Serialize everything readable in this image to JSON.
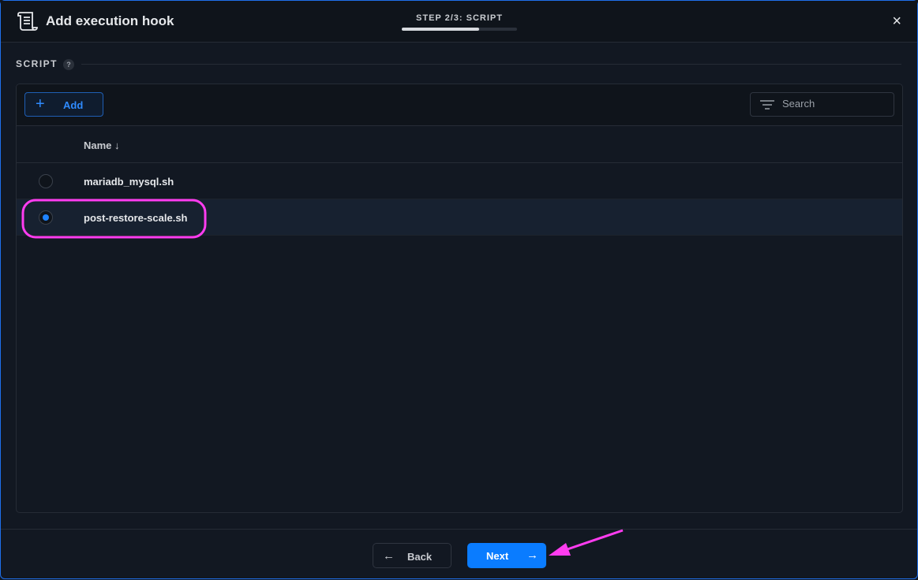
{
  "header": {
    "title": "Add execution hook",
    "step_label": "STEP 2/3: SCRIPT",
    "progress": 0.67,
    "close_icon": "×"
  },
  "section": {
    "title": "SCRIPT",
    "help": "?"
  },
  "toolbar": {
    "add_label": "Add",
    "add_icon": "+",
    "search_placeholder": "Search"
  },
  "table": {
    "column": "Name ↓",
    "rows": [
      {
        "name": "mariadb_mysql.sh",
        "selected": false
      },
      {
        "name": "post-restore-scale.sh",
        "selected": true
      }
    ]
  },
  "footer": {
    "back_label": "Back",
    "back_icon": "←",
    "next_label": "Next",
    "next_icon": "→"
  },
  "colors": {
    "accent": "#0a7cff",
    "annotation": "#ff3cf0"
  }
}
